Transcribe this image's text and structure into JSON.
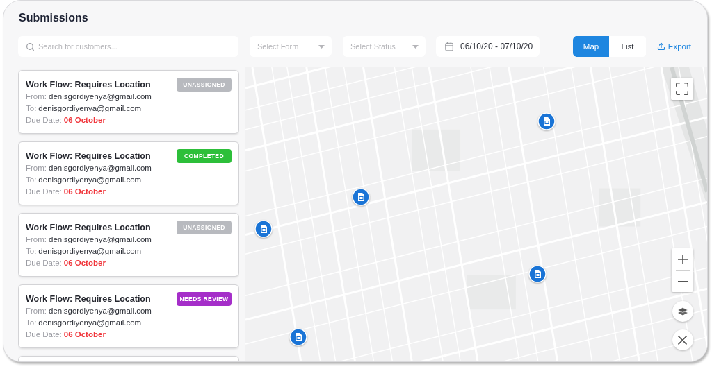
{
  "title": "Submissions",
  "toolbar": {
    "search": {
      "placeholder": "Search for customers..."
    },
    "filters": [
      {
        "placeholder": "Select Form"
      },
      {
        "placeholder": "Select Status"
      }
    ],
    "date_range": "06/10/20 - 07/10/20",
    "view_toggle": [
      {
        "label": "Map",
        "selected": true
      },
      {
        "label": "List",
        "selected": false
      }
    ],
    "export": "Export"
  },
  "submissions": [
    {
      "title": "Work Flow: Requires Location",
      "status": {
        "label": "UNASSIGNED",
        "color": "#b8babf"
      },
      "from_label": "From:",
      "from": "denisgordiyenya@gmail.com",
      "to_label": "To:",
      "to": "denisgordiyenya@gmail.com",
      "due_label": "Due Date:",
      "due": "06 October"
    },
    {
      "title": "Work Flow: Requires Location",
      "status": {
        "label": "COMPLETED",
        "color": "#2dbf3a"
      },
      "from_label": "From:",
      "from": "denisgordiyenya@gmail.com",
      "to_label": "To:",
      "to": "denisgordiyenya@gmail.com",
      "due_label": "Due Date:",
      "due": "06 October"
    },
    {
      "title": "Work Flow: Requires Location",
      "status": {
        "label": "UNASSIGNED",
        "color": "#b8babf"
      },
      "from_label": "From:",
      "from": "denisgordiyenya@gmail.com",
      "to_label": "To:",
      "to": "denisgordiyenya@gmail.com",
      "due_label": "Due Date:",
      "due": "06 October"
    },
    {
      "title": "Work Flow: Requires Location",
      "status": {
        "label": "NEEDS REVIEW",
        "color": "#a52ec9"
      },
      "from_label": "From:",
      "from": "denisgordiyenya@gmail.com",
      "to_label": "To:",
      "to": "denisgordiyenya@gmail.com",
      "due_label": "Due Date:",
      "due": "06 October"
    }
  ],
  "more_below": true
}
